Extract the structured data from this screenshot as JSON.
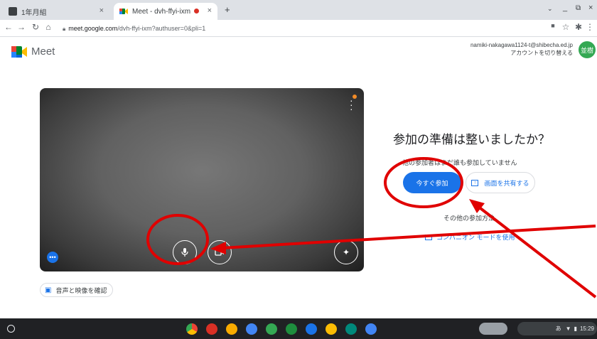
{
  "browser": {
    "tabs": [
      {
        "label": "1年月組",
        "close": "×"
      },
      {
        "label": "Meet - dvh-ffyi-ixm",
        "close": "×"
      }
    ],
    "new_tab": "+",
    "window_controls": {
      "minimize": "_",
      "restore": "⧉",
      "close": "×"
    },
    "url_host": "meet.google.com",
    "url_path": "/dvh-ffyi-ixm?authuser=0&pli=1"
  },
  "meet": {
    "logo_text": "Meet",
    "account_email": "namiki-nakagawa1124-t@shibecha.ed.jp",
    "switch_account": "アカウントを切り替える",
    "avatar_text": "並樹"
  },
  "preview": {
    "check_av_label": "音声と映像を確認"
  },
  "join": {
    "title": "参加の準備は整いましたか？",
    "no_one_here": "他の参加者はまだ誰も参加していません",
    "join_now": "今すぐ参加",
    "share_screen": "画面を共有する",
    "other_ways": "その他の参加方法",
    "companion_mode": "コンパニオン モードを使用"
  },
  "shelf": {
    "time": "15:29",
    "ime": "あ"
  },
  "colors": {
    "accent": "#1a73e8",
    "annotation": "#e00000"
  }
}
